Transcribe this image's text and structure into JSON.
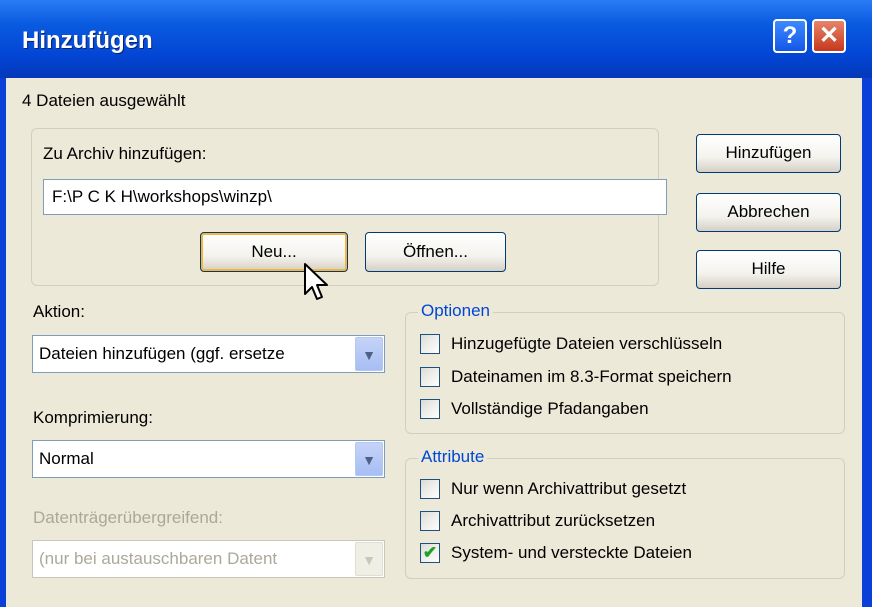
{
  "window": {
    "title": "Hinzufügen"
  },
  "status": "4 Dateien ausgewählt",
  "archive": {
    "label": "Zu Archiv hinzufügen:",
    "path": "F:\\P C K H\\workshops\\winzp\\",
    "new_label": "Neu...",
    "open_label": "Öffnen..."
  },
  "buttons": {
    "add": "Hinzufügen",
    "cancel": "Abbrechen",
    "help": "Hilfe"
  },
  "action": {
    "label": "Aktion:",
    "value": "Dateien hinzufügen (ggf. ersetze"
  },
  "compression": {
    "label": "Komprimierung:",
    "value": "Normal"
  },
  "spanning": {
    "label": "Datenträgerübergreifend:",
    "value": "(nur bei austauschbaren Datent"
  },
  "options": {
    "title": "Optionen",
    "items": [
      {
        "label": "Hinzugefügte Dateien verschlüsseln",
        "checked": false
      },
      {
        "label": "Dateinamen im 8.3-Format speichern",
        "checked": false
      },
      {
        "label": "Vollständige Pfadangaben",
        "checked": false
      }
    ]
  },
  "attributes": {
    "title": "Attribute",
    "items": [
      {
        "label": "Nur wenn Archivattribut gesetzt",
        "checked": false
      },
      {
        "label": "Archivattribut zurücksetzen",
        "checked": false
      },
      {
        "label": "System- und versteckte Dateien",
        "checked": true
      }
    ]
  }
}
